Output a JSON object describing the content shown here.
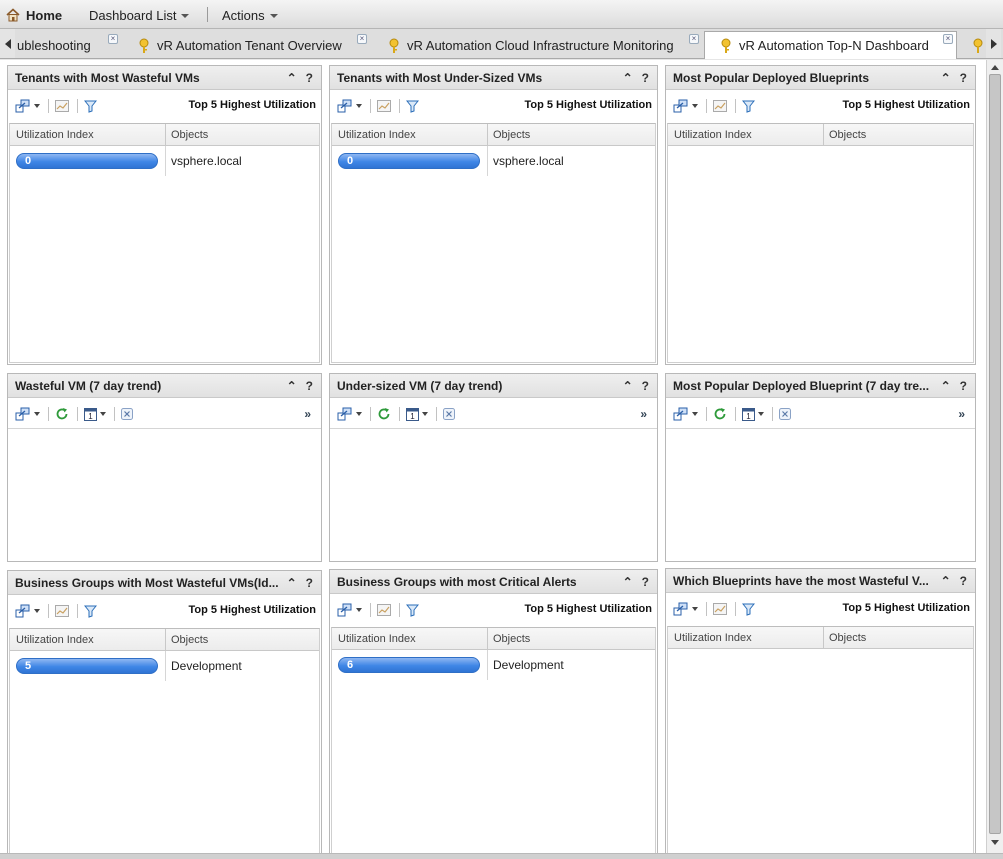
{
  "topbar": {
    "home_label": "Home",
    "dashboard_list_label": "Dashboard List",
    "actions_label": "Actions"
  },
  "tabs": [
    {
      "label": "ubleshooting"
    },
    {
      "label": "vR Automation Tenant Overview"
    },
    {
      "label": "vR Automation Cloud Infrastructure Monitoring"
    },
    {
      "label": "vR Automation Top-N Dashboard",
      "active": true
    }
  ],
  "colors": {
    "accent": "#3f86e6",
    "refresh": "#2e9a3a"
  },
  "widgets": [
    {
      "title": "Tenants with Most Wasteful VMs",
      "toolbar_title": "Top 5 Highest Utilization",
      "col1": "Utilization Index",
      "col2": "Objects",
      "rows": [
        {
          "value": "0",
          "object": "vsphere.local"
        }
      ]
    },
    {
      "title": "Tenants with Most Under-Sized VMs",
      "toolbar_title": "Top 5 Highest Utilization",
      "col1": "Utilization Index",
      "col2": "Objects",
      "rows": [
        {
          "value": "0",
          "object": "vsphere.local"
        }
      ]
    },
    {
      "title": "Most Popular Deployed Blueprints",
      "toolbar_title": "Top 5 Highest Utilization",
      "col1": "Utilization Index",
      "col2": "Objects",
      "rows": []
    },
    {
      "title": "Wasteful VM (7 day trend)",
      "more": "»"
    },
    {
      "title": "Under-sized VM (7 day trend)",
      "more": "»"
    },
    {
      "title": "Most Popular Deployed Blueprint (7 day tre...",
      "more": "»"
    },
    {
      "title": "Business Groups with Most Wasteful VMs(Id...",
      "toolbar_title": "Top 5 Highest Utilization",
      "col1": "Utilization Index",
      "col2": "Objects",
      "rows": [
        {
          "value": "5",
          "object": "Development"
        }
      ]
    },
    {
      "title": "Business Groups with most Critical Alerts",
      "toolbar_title": "Top 5 Highest Utilization",
      "col1": "Utilization Index",
      "col2": "Objects",
      "rows": [
        {
          "value": "6",
          "object": "Development"
        }
      ]
    },
    {
      "title": "Which Blueprints have the most Wasteful V...",
      "toolbar_title": "Top 5 Highest Utilization",
      "col1": "Utilization Index",
      "col2": "Objects",
      "rows": []
    }
  ],
  "widget_buttons": {
    "collapse": "⌃",
    "help": "?"
  }
}
